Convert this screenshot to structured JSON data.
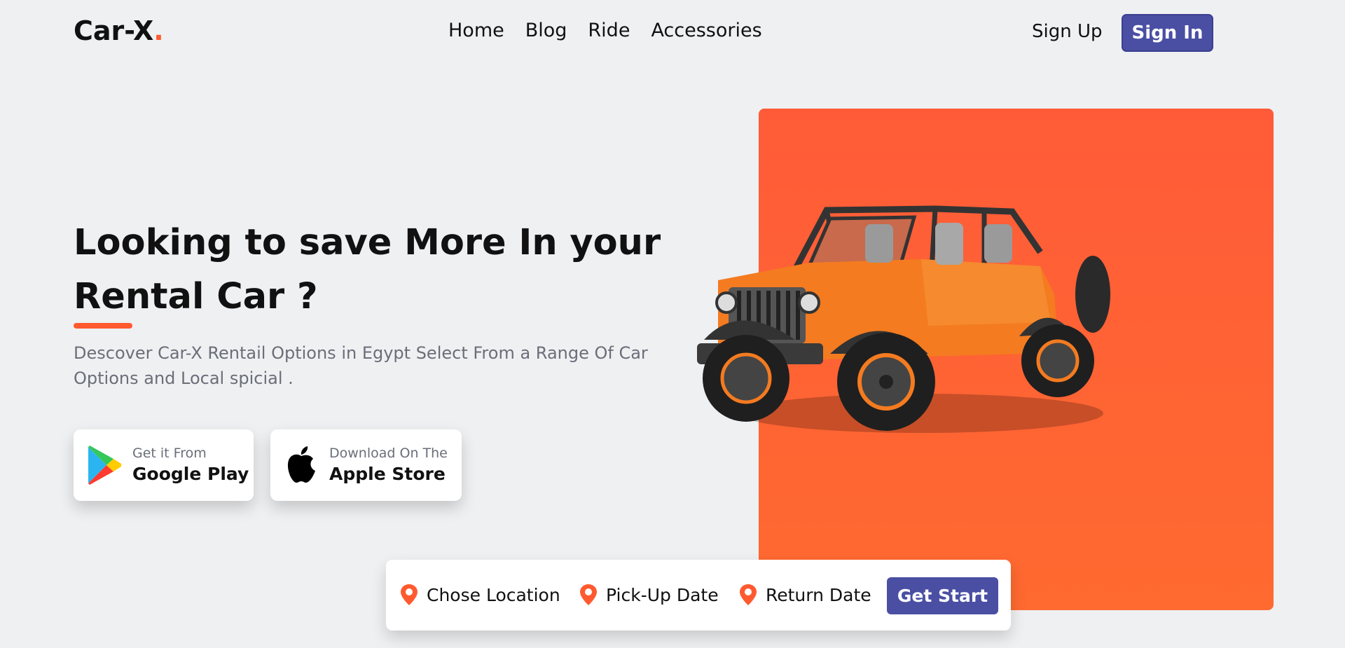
{
  "brand": {
    "name": "Car-X",
    "dot": ".",
    "accent_color": "#ff5a2f"
  },
  "nav": {
    "items": [
      {
        "label": "Home"
      },
      {
        "label": "Blog"
      },
      {
        "label": "Ride"
      },
      {
        "label": "Accessories"
      }
    ]
  },
  "auth": {
    "sign_up": "Sign Up",
    "sign_in": "Sign In",
    "button_color": "#4a4fa3"
  },
  "hero": {
    "title": "Looking to save More In your Rental Car ?",
    "description": "Descover Car-X Rentail Options in Egypt Select From a Range Of Car Options and Local spicial ."
  },
  "stores": {
    "google": {
      "small": "Get it From",
      "big": "Google Play",
      "icon": "google-play-icon"
    },
    "apple": {
      "small": "Download On The",
      "big": "Apple Store",
      "icon": "apple-icon"
    }
  },
  "search": {
    "location": "Chose Location",
    "pickup": "Pick-Up Date",
    "return": "Return Date",
    "submit": "Get Start",
    "pin_icon": "location-pin-icon"
  }
}
